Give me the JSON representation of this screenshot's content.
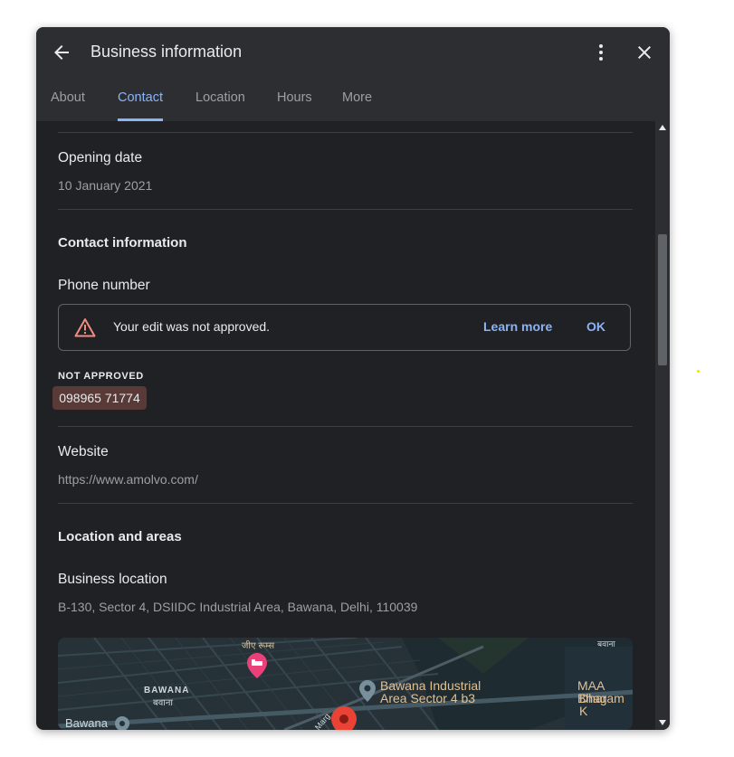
{
  "header": {
    "title": "Business information",
    "icons": {
      "back": "arrow-back-icon",
      "more": "more-vert-icon",
      "close": "close-icon"
    }
  },
  "tabs": [
    {
      "label": "About",
      "active": false
    },
    {
      "label": "Contact",
      "active": true
    },
    {
      "label": "Location",
      "active": false
    },
    {
      "label": "Hours",
      "active": false
    },
    {
      "label": "More",
      "active": false
    }
  ],
  "opening_date": {
    "label": "Opening date",
    "value": "10 January 2021"
  },
  "contact_section": {
    "title": "Contact information"
  },
  "phone": {
    "label": "Phone number",
    "alert": {
      "message": "Your edit was not approved.",
      "learn_more": "Learn more",
      "ok": "OK",
      "icon": "warning-icon"
    },
    "status": "NOT APPROVED",
    "value": "098965 71774"
  },
  "website": {
    "label": "Website",
    "value": "https://www.amolvo.com/"
  },
  "location_section": {
    "title": "Location and areas"
  },
  "business_location": {
    "label": "Business location",
    "address": "B-130, Sector 4, DSIIDC Industrial Area, Bawana, Delhi, 110039"
  },
  "map": {
    "labels": {
      "hindi_top": "जीए रूम्स",
      "bawana_en": "BAWANA",
      "bawana_hi": "बवाना",
      "industrial_line1": "Bawana Industrial",
      "industrial_line2": "Area Sector 4 b3",
      "maa_line1": "MAA Bhag",
      "maa_line2": "Dharam K",
      "bawana_place": "Bawana",
      "marg": "Marg",
      "top_right": "बवाना"
    }
  },
  "colors": {
    "background": "#202124",
    "header": "#2d2e31",
    "accent": "#8ab4f8",
    "warning": "#f28b82",
    "chip": "#5a3a37"
  }
}
